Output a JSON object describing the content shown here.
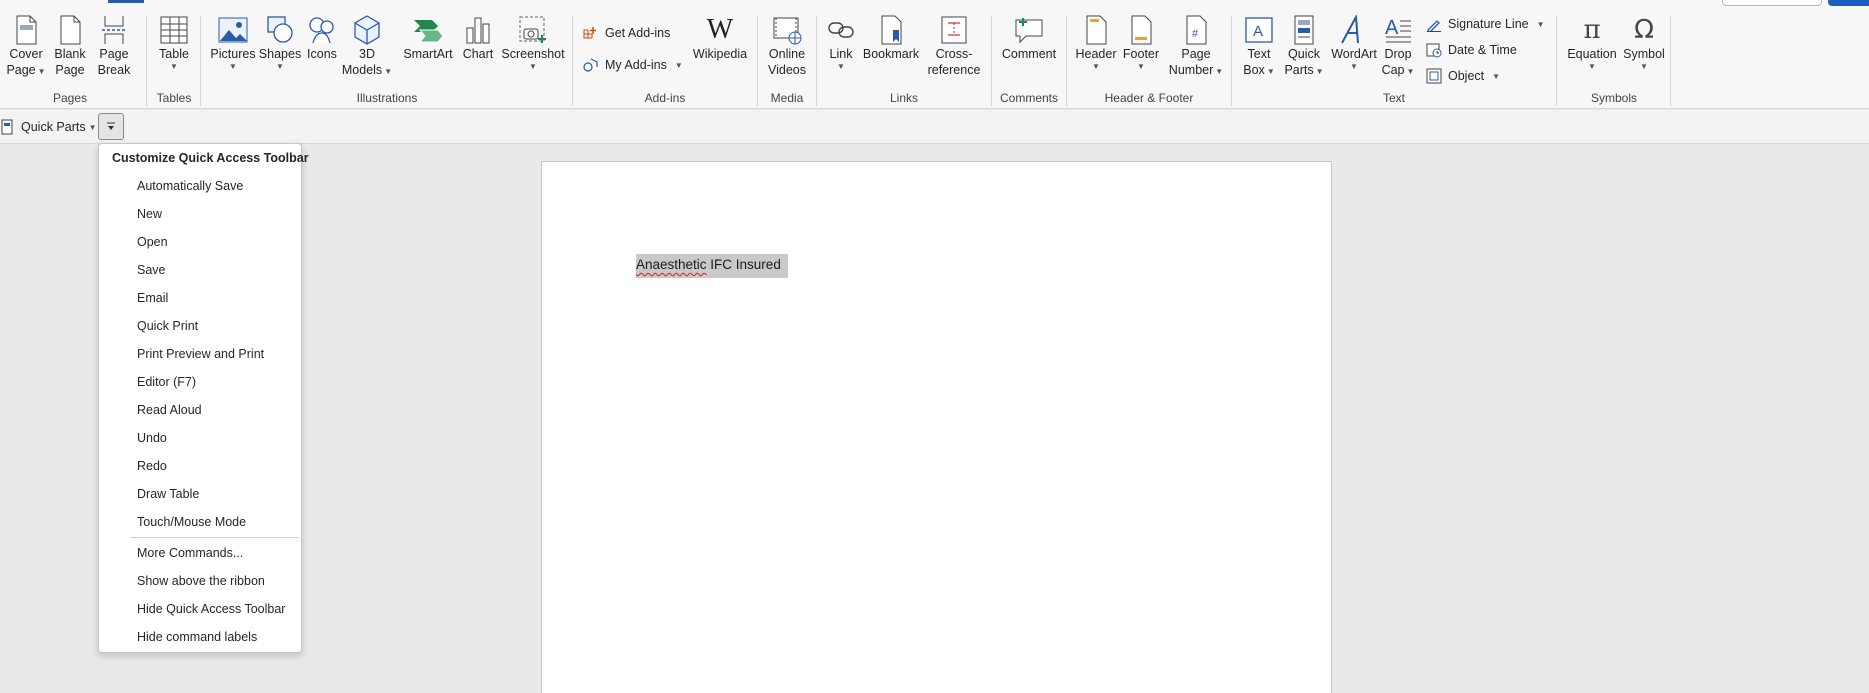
{
  "ribbon": {
    "pages": {
      "label": "Pages",
      "cover_page": [
        "Cover",
        "Page"
      ],
      "blank_page": [
        "Blank",
        "Page"
      ],
      "page_break": [
        "Page",
        "Break"
      ]
    },
    "tables": {
      "label": "Tables",
      "table": "Table"
    },
    "illustrations": {
      "label": "Illustrations",
      "pictures": "Pictures",
      "shapes": "Shapes",
      "icons": "Icons",
      "models_3d": [
        "3D",
        "Models"
      ],
      "smartart": "SmartArt",
      "chart": "Chart",
      "screenshot": "Screenshot"
    },
    "addins": {
      "label": "Add-ins",
      "get_addins": "Get Add-ins",
      "my_addins": "My Add-ins",
      "wikipedia": "Wikipedia"
    },
    "media": {
      "label": "Media",
      "online_videos": [
        "Online",
        "Videos"
      ]
    },
    "links": {
      "label": "Links",
      "link": "Link",
      "bookmark": "Bookmark",
      "cross_reference": [
        "Cross-",
        "reference"
      ]
    },
    "comments": {
      "label": "Comments",
      "comment": "Comment"
    },
    "header_footer": {
      "label": "Header & Footer",
      "header": "Header",
      "footer": "Footer",
      "page_number": [
        "Page",
        "Number"
      ]
    },
    "text": {
      "label": "Text",
      "text_box": [
        "Text",
        "Box"
      ],
      "quick_parts": [
        "Quick",
        "Parts"
      ],
      "wordart": "WordArt",
      "drop_cap": [
        "Drop",
        "Cap"
      ],
      "signature_line": "Signature Line",
      "date_time": "Date & Time",
      "object": "Object"
    },
    "symbols": {
      "label": "Symbols",
      "equation": "Equation",
      "symbol": "Symbol"
    }
  },
  "qat": {
    "quick_parts": "Quick Parts"
  },
  "document": {
    "word1": "Anaesthetic",
    "rest": " IFC Insured"
  },
  "menu": {
    "title": "Customize Quick Access Toolbar",
    "items": [
      "Automatically Save",
      "New",
      "Open",
      "Save",
      "Email",
      "Quick Print",
      "Print Preview and Print",
      "Editor (F7)",
      "Read Aloud",
      "Undo",
      "Redo",
      "Draw Table",
      "Touch/Mouse Mode"
    ],
    "more_commands": "More Commands...",
    "show_above": "Show above the ribbon",
    "hide_qat": "Hide Quick Access Toolbar",
    "hide_labels": "Hide command labels"
  },
  "colors": {
    "accent_blue": "#2b5aa8",
    "green": "#1f8a4c",
    "red": "#d13438",
    "selection": "#c9c9c9"
  }
}
